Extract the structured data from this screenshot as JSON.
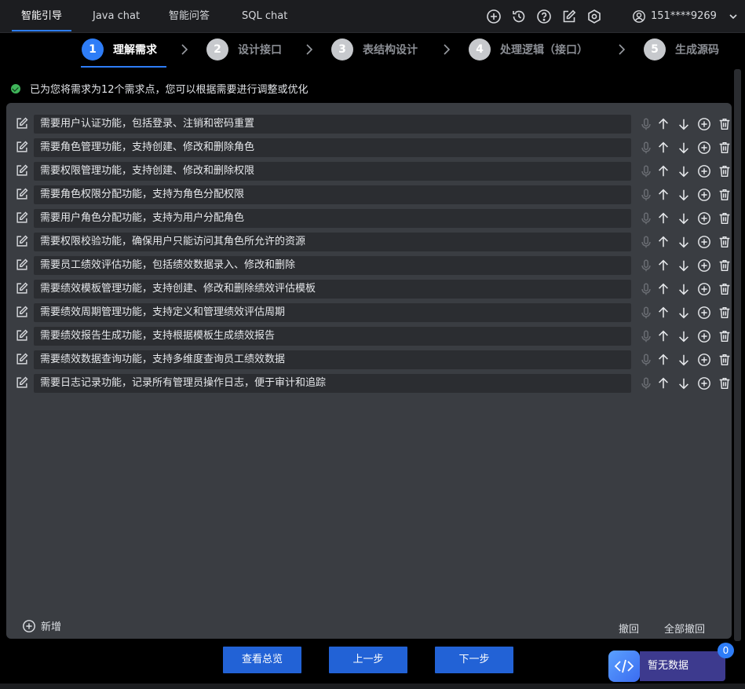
{
  "topbar": {
    "tabs": [
      {
        "label": "智能引导"
      },
      {
        "label": "Java chat"
      },
      {
        "label": "智能问答"
      },
      {
        "label": "SQL chat"
      }
    ],
    "icons": [
      "plus-circle-icon",
      "history-icon",
      "help-icon",
      "edit-icon",
      "settings-icon"
    ],
    "user": {
      "phone": "151****9269"
    }
  },
  "steps": [
    {
      "num": "1",
      "label": "理解需求",
      "active": true
    },
    {
      "num": "2",
      "label": "设计接口",
      "active": false
    },
    {
      "num": "3",
      "label": "表结构设计",
      "active": false
    },
    {
      "num": "4",
      "label": "处理逻辑（接口）",
      "active": false
    },
    {
      "num": "5",
      "label": "生成源码",
      "active": false
    }
  ],
  "notice": {
    "text": "已为您将需求为12个需求点，您可以根据需要进行调整或优化"
  },
  "requirements": [
    {
      "text": "需要用户认证功能，包括登录、注销和密码重置"
    },
    {
      "text": "需要角色管理功能，支持创建、修改和删除角色"
    },
    {
      "text": "需要权限管理功能，支持创建、修改和删除权限"
    },
    {
      "text": "需要角色权限分配功能，支持为角色分配权限"
    },
    {
      "text": "需要用户角色分配功能，支持为用户分配角色"
    },
    {
      "text": "需要权限校验功能，确保用户只能访问其角色所允许的资源"
    },
    {
      "text": "需要员工绩效评估功能，包括绩效数据录入、修改和删除"
    },
    {
      "text": "需要绩效模板管理功能，支持创建、修改和删除绩效评估模板"
    },
    {
      "text": "需要绩效周期管理功能，支持定义和管理绩效评估周期"
    },
    {
      "text": "需要绩效报告生成功能，支持根据模板生成绩效报告"
    },
    {
      "text": "需要绩效数据查询功能，支持多维度查询员工绩效数据"
    },
    {
      "text": "需要日志记录功能，记录所有管理员操作日志，便于审计和追踪"
    }
  ],
  "panel": {
    "add_label": "新增",
    "undo_label": "撤回",
    "undo_all_label": "全部撤回"
  },
  "footer": {
    "overview_label": "查看总览",
    "prev_label": "上一步",
    "next_label": "下一步"
  },
  "widget": {
    "label": "暂无数据",
    "badge": "0"
  },
  "colors": {
    "accent": "#2e7df7",
    "button": "#2262d6",
    "panel": "#3a3d42",
    "success": "#3fb55a"
  }
}
